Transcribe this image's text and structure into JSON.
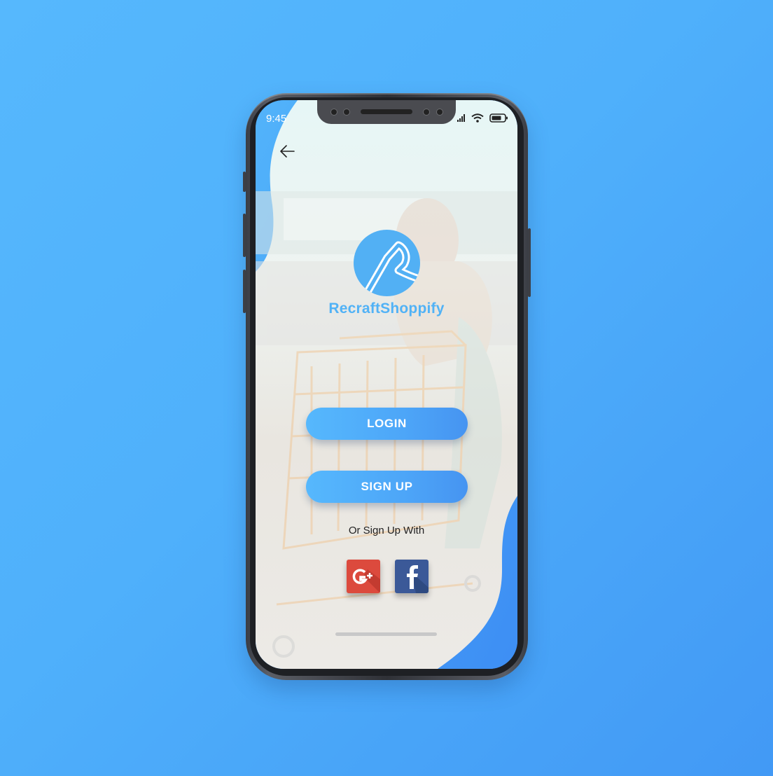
{
  "status_bar": {
    "time": "9:45",
    "signal_icon": "cellular-signal-icon",
    "wifi_icon": "wifi-icon",
    "battery_icon": "battery-icon"
  },
  "nav": {
    "back_icon": "back-arrow-icon"
  },
  "brand": {
    "logo_icon": "recraftshoppify-logo",
    "name": "RecraftShoppify",
    "color": "#51b2f6"
  },
  "actions": {
    "login_label": "LOGIN",
    "signup_label": "SIGN UP",
    "button_color": "#56b8fd"
  },
  "social": {
    "prompt": "Or Sign Up With",
    "google": {
      "icon": "google-plus-icon",
      "color": "#dc4a3d"
    },
    "facebook": {
      "icon": "facebook-icon",
      "color": "#3b5998"
    }
  },
  "colors": {
    "background": "#52b4fc",
    "accent_blob": "#3d8ef4"
  }
}
